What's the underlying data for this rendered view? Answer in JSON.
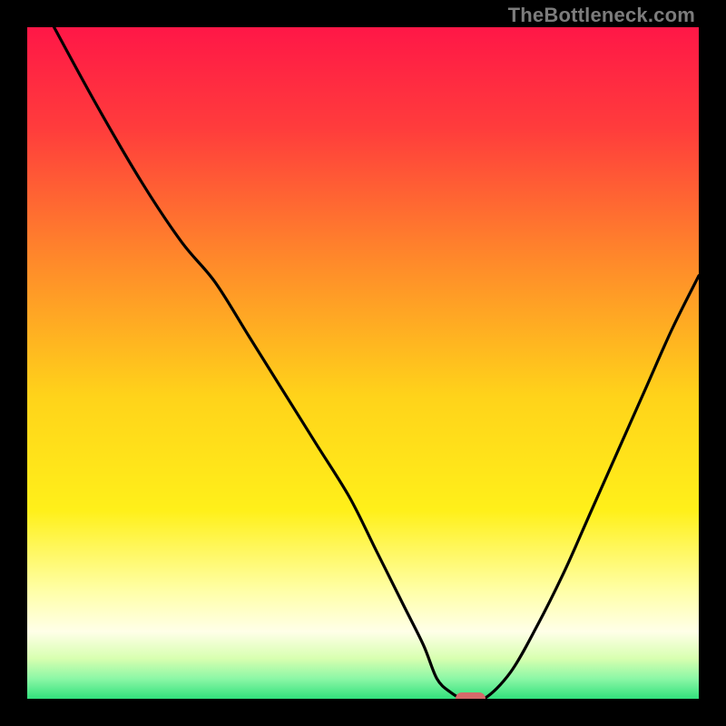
{
  "watermark": "TheBottleneck.com",
  "colors": {
    "frame": "#000000",
    "gradient_stops": [
      {
        "pct": 0,
        "color": "#ff1747"
      },
      {
        "pct": 15,
        "color": "#ff3c3c"
      },
      {
        "pct": 35,
        "color": "#ff8a2a"
      },
      {
        "pct": 55,
        "color": "#ffd31a"
      },
      {
        "pct": 72,
        "color": "#fff01a"
      },
      {
        "pct": 84,
        "color": "#ffffa8"
      },
      {
        "pct": 90,
        "color": "#ffffe8"
      },
      {
        "pct": 94,
        "color": "#d8ffb0"
      },
      {
        "pct": 97,
        "color": "#8cf7a6"
      },
      {
        "pct": 100,
        "color": "#32e07c"
      }
    ],
    "curve": "#000000",
    "marker": "#d56a6a"
  },
  "chart_data": {
    "type": "line",
    "title": "",
    "xlabel": "",
    "ylabel": "",
    "xlim": [
      0,
      100
    ],
    "ylim": [
      0,
      100
    ],
    "grid": false,
    "legend": false,
    "annotations": [
      "TheBottleneck.com"
    ],
    "series": [
      {
        "name": "bottleneck-curve",
        "x": [
          4,
          10,
          17,
          23,
          28,
          33,
          38,
          43,
          48,
          52,
          56,
          59,
          61,
          63,
          65,
          68,
          72,
          76,
          80,
          84,
          88,
          92,
          96,
          100
        ],
        "y": [
          100,
          89,
          77,
          68,
          62,
          54,
          46,
          38,
          30,
          22,
          14,
          8,
          3,
          1,
          0,
          0,
          4,
          11,
          19,
          28,
          37,
          46,
          55,
          63
        ]
      }
    ],
    "marker": {
      "x": 66,
      "y": 0,
      "width_pct": 4.5,
      "height_pct": 1.8
    }
  }
}
